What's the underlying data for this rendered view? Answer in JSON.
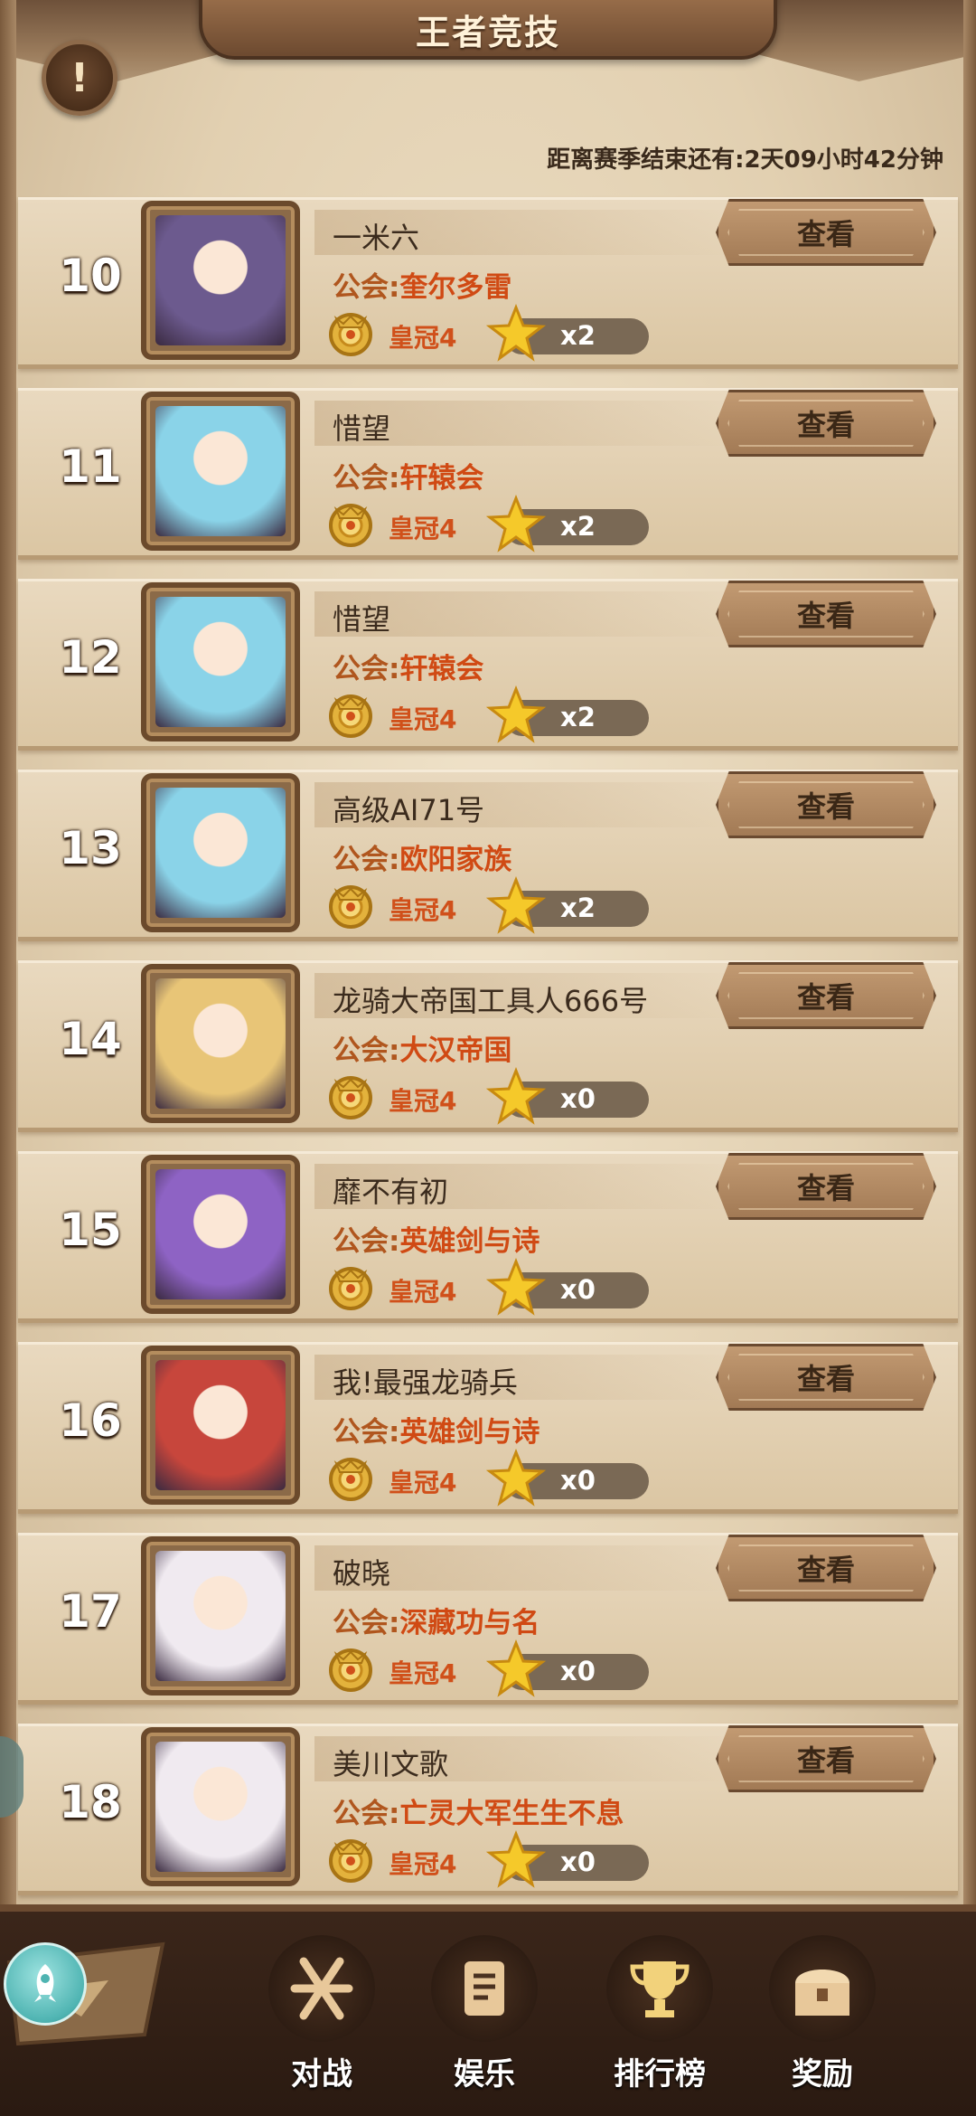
{
  "header": {
    "title": "王者竞技",
    "info_icon": "!",
    "season_timer_label": "距离赛季结束还有:",
    "season_timer_value": "2天09小时42分钟"
  },
  "ranking": {
    "guild_prefix": "公会:",
    "view_label": "查看",
    "rows": [
      {
        "rank": "10",
        "name": "一米六",
        "guild": "奎尔多雷",
        "tier": "皇冠4",
        "stars": "x2",
        "avatar": "dark-elf-sorceress",
        "avatar_color": "#6c5a8e"
      },
      {
        "rank": "11",
        "name": "惜望",
        "guild": "轩辕会",
        "tier": "皇冠4",
        "stars": "x2",
        "avatar": "blue-haired-girl",
        "avatar_color": "#8ad3e8"
      },
      {
        "rank": "12",
        "name": "惜望",
        "guild": "轩辕会",
        "tier": "皇冠4",
        "stars": "x2",
        "avatar": "blue-haired-girl",
        "avatar_color": "#8ad3e8"
      },
      {
        "rank": "13",
        "name": "高级AI71号",
        "guild": "欧阳家族",
        "tier": "皇冠4",
        "stars": "x2",
        "avatar": "blue-haired-girl",
        "avatar_color": "#8ad3e8"
      },
      {
        "rank": "14",
        "name": "龙骑大帝国工具人666号",
        "guild": "大汉帝国",
        "tier": "皇冠4",
        "stars": "x0",
        "avatar": "blonde-knight",
        "avatar_color": "#e8c577"
      },
      {
        "rank": "15",
        "name": "靡不有初",
        "guild": "英雄剑与诗",
        "tier": "皇冠4",
        "stars": "x0",
        "avatar": "purple-haired-mage",
        "avatar_color": "#8e63c4"
      },
      {
        "rank": "16",
        "name": "我!最强龙骑兵",
        "guild": "英雄剑与诗",
        "tier": "皇冠4",
        "stars": "x0",
        "avatar": "red-demon-warrior",
        "avatar_color": "#c7463c"
      },
      {
        "rank": "17",
        "name": "破晓",
        "guild": "深藏功与名",
        "tier": "皇冠4",
        "stars": "x0",
        "avatar": "white-haired-demon-girl",
        "avatar_color": "#f0eaf0"
      },
      {
        "rank": "18",
        "name": "美川文歌",
        "guild": "亡灵大军生生不息",
        "tier": "皇冠4",
        "stars": "x0",
        "avatar": "white-haired-demon-girl",
        "avatar_color": "#f0eaf0"
      }
    ]
  },
  "nav": {
    "items": [
      {
        "label": "对战",
        "icon": "battle-icon"
      },
      {
        "label": "娱乐",
        "icon": "scroll-icon"
      },
      {
        "label": "排行榜",
        "icon": "trophy-icon"
      },
      {
        "label": "奖励",
        "icon": "treasure-chest-icon"
      }
    ]
  },
  "colors": {
    "guild_name": "#d04a14",
    "panel": "#e2d0b1",
    "bottom_bar": "#2a1a11"
  }
}
